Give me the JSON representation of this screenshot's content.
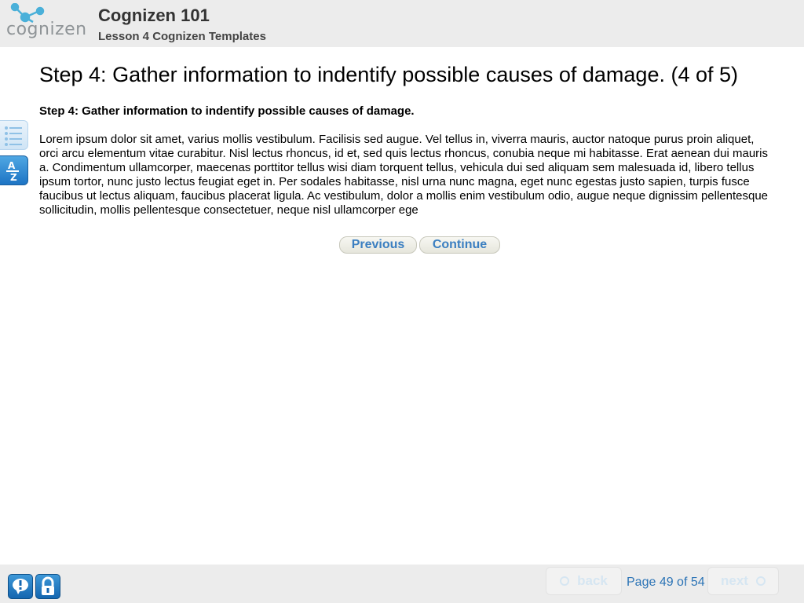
{
  "header": {
    "logo_text": "cognizen",
    "course_title": "Cognizen 101",
    "lesson_title": "Lesson 4 Cognizen Templates"
  },
  "content": {
    "page_title": "Step 4: Gather information to indentify possible causes of damage. (4 of 5)",
    "subtitle": "Step 4: Gather information to indentify possible causes of damage.",
    "body": "Lorem ipsum dolor sit amet, varius mollis vestibulum. Facilisis sed augue. Vel tellus in, viverra mauris, auctor natoque purus proin aliquet, orci arcu elementum vitae curabitur. Nisl lectus rhoncus, id et, sed quis lectus rhoncus, conubia neque mi habitasse. Erat aenean dui mauris a. Condimentum ullamcorper, maecenas porttitor tellus wisi diam torquent tellus, vehicula dui sed aliquam sem malesuada id, libero tellus ipsum tortor, nunc justo lectus feugiat eget in. Per sodales habitasse, nisl urna nunc magna, eget nunc egestas justo sapien, turpis fusce faucibus ut lectus aliquam, faucibus placerat ligula. Ac vestibulum, dolor a mollis enim vestibulum odio, augue neque dignissim pellentesque sollicitudin, mollis pellentesque consectetuer, neque nisl ullamcorper ege"
  },
  "side_tools": {
    "toc_icon": "list-icon",
    "glossary_icon": "az-glossary-icon",
    "glossary_letters": [
      "A",
      "Z"
    ]
  },
  "nav": {
    "previous_label": "Previous",
    "continue_label": "Continue"
  },
  "footer": {
    "help_icon": "help-icon",
    "lock_icon": "lock-icon",
    "back_label": "back",
    "next_label": "next",
    "page_counter": "Page 49 of 54"
  },
  "colors": {
    "accent": "#3b7fc1",
    "header_bg": "#ececec",
    "icon_blue": "#1d74c4"
  }
}
